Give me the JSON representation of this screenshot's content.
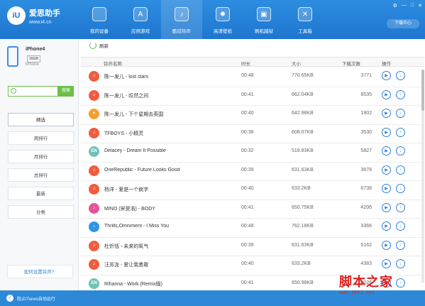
{
  "app": {
    "logo": "iU",
    "brand_name": "爱思助手",
    "brand_url": "www.i4.cn",
    "download_center": "下载中心",
    "window_controls": [
      "⚙",
      "—",
      "□",
      "✕"
    ]
  },
  "nav": {
    "items": [
      {
        "label": "我的设备",
        "icon": "apple-icon",
        "glyph": ""
      },
      {
        "label": "应用游戏",
        "icon": "app-store-icon",
        "glyph": "A"
      },
      {
        "label": "酷炫铃声",
        "icon": "bell-icon",
        "glyph": "♪",
        "active": true
      },
      {
        "label": "高清壁纸",
        "icon": "wallpaper-icon",
        "glyph": "✹"
      },
      {
        "label": "刷机越狱",
        "icon": "box-icon",
        "glyph": "▣"
      },
      {
        "label": "工具箱",
        "icon": "tools-icon",
        "glyph": "✕"
      }
    ]
  },
  "device": {
    "name": "iPhone4",
    "capacity": "16GB",
    "type": "iPhone"
  },
  "search": {
    "placeholder": "",
    "button_label": "搜索"
  },
  "side_nav": {
    "items": [
      {
        "label": "精选",
        "active": true
      },
      {
        "label": "周排行"
      },
      {
        "label": "月排行"
      },
      {
        "label": "总排行"
      },
      {
        "label": "最新"
      },
      {
        "label": "分类"
      }
    ]
  },
  "help_link": "如何设置铃声？",
  "refresh_label": "刷新",
  "table": {
    "headers": {
      "name": "铃声名称",
      "duration": "时长",
      "size": "大小",
      "downloads": "下载次数",
      "actions": "操作"
    },
    "rows": [
      {
        "name": "陈一发儿 - lost stars",
        "duration": "00:48",
        "size": "770.65KB",
        "downloads": "3771",
        "icon": "music-note-icon",
        "icon_text": "♫",
        "icon_color": "#f15b3e"
      },
      {
        "name": "陈一发儿 - 叹然之间",
        "duration": "00:41",
        "size": "662.04KB",
        "downloads": "8535",
        "icon": "music-note-icon",
        "icon_text": "♫",
        "icon_color": "#f15b3e"
      },
      {
        "name": "陈一发儿 - 下个星期去英国",
        "duration": "00:40",
        "size": "642.98KB",
        "downloads": "1902",
        "icon": "badge-icon",
        "icon_text": "✦",
        "icon_color": "#f3a02d"
      },
      {
        "name": "TFBOYS - 小精灵",
        "duration": "00:38",
        "size": "608.07KB",
        "downloads": "3530",
        "icon": "music-note-icon",
        "icon_text": "♫",
        "icon_color": "#f15b3e"
      },
      {
        "name": "Delacey - Dream It Possible",
        "duration": "00:32",
        "size": "518.83KB",
        "downloads": "5827",
        "icon": "en-icon",
        "icon_text": "EN",
        "icon_color": "#6ec3b4"
      },
      {
        "name": "OneRepublic - Future Looks Good",
        "duration": "00:39",
        "size": "631.63KB",
        "downloads": "3678",
        "icon": "music-note-icon",
        "icon_text": "♫",
        "icon_color": "#f15b3e"
      },
      {
        "name": "杨洋 - 爱是一个疯字",
        "duration": "00:40",
        "size": "633.2KB",
        "downloads": "6738",
        "icon": "music-note-icon",
        "icon_text": "♫",
        "icon_color": "#f15b3e"
      },
      {
        "name": "MINO (宋旻浩) - BODY",
        "duration": "00:41",
        "size": "650.75KB",
        "downloads": "4206",
        "icon": "music-disc-icon",
        "icon_text": "♪",
        "icon_color": "#e55595"
      },
      {
        "name": "Thrills,Omniment - I Miss You",
        "duration": "00:48",
        "size": "762.18KB",
        "downloads": "3366",
        "icon": "music-note-icon",
        "icon_text": "♪",
        "icon_color": "#2d97e6"
      },
      {
        "name": "杜忻恬 - 未来的氧气",
        "duration": "00:39",
        "size": "631.63KB",
        "downloads": "5162",
        "icon": "music-note-icon",
        "icon_text": "♫",
        "icon_color": "#f15b3e"
      },
      {
        "name": "汪苏泷 - 爱让我勇敢",
        "duration": "00:40",
        "size": "633.2KB",
        "downloads": "4383",
        "icon": "music-note-icon",
        "icon_text": "♫",
        "icon_color": "#f15b3e"
      },
      {
        "name": "Rihanna - Work (Remix版)",
        "duration": "00:41",
        "size": "650.98KB",
        "downloads": "4026",
        "icon": "en-icon",
        "icon_text": "EN",
        "icon_color": "#6ec3b4"
      }
    ]
  },
  "bottom": {
    "check": "✓",
    "text": "阻止iTunes自动运行"
  },
  "watermark": {
    "title": "脚本之家",
    "url": "www.jb51.net"
  }
}
